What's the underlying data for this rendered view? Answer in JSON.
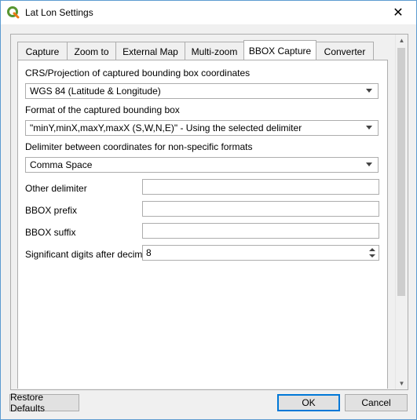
{
  "window": {
    "title": "Lat Lon Settings",
    "close_glyph": "✕"
  },
  "tabs": [
    {
      "label": "Capture"
    },
    {
      "label": "Zoom to"
    },
    {
      "label": "External Map"
    },
    {
      "label": "Multi-zoom"
    },
    {
      "label": "BBOX Capture",
      "active": true
    },
    {
      "label": "Converter"
    }
  ],
  "form": {
    "crs_label": "CRS/Projection of captured bounding box coordinates",
    "crs_value": "WGS 84 (Latitude & Longitude)",
    "format_label": "Format of the captured bounding box",
    "format_value": "\"minY,minX,maxY,maxX (S,W,N,E)\" - Using the selected delimiter",
    "delimiter_label": "Delimiter between coordinates for non-specific formats",
    "delimiter_value": "Comma Space",
    "other_delim_label": "Other delimiter",
    "other_delim_value": "",
    "prefix_label": "BBOX prefix",
    "prefix_value": "",
    "suffix_label": "BBOX suffix",
    "suffix_value": "",
    "digits_label": "Significant digits after decimal",
    "digits_value": "8"
  },
  "buttons": {
    "restore": "Restore Defaults",
    "ok": "OK",
    "cancel": "Cancel"
  },
  "colors": {
    "accent": "#0078d7",
    "qgis_green": "#589632"
  }
}
